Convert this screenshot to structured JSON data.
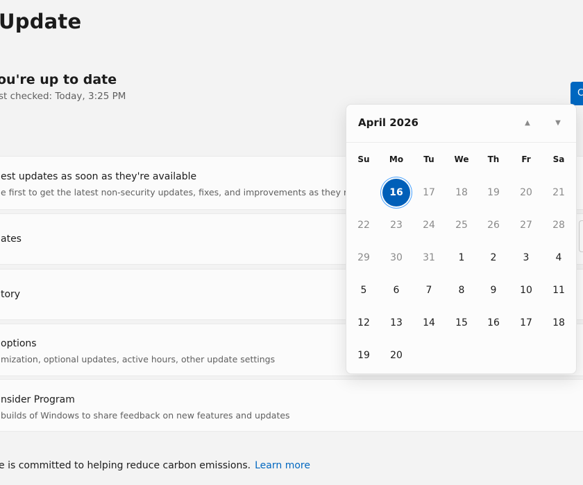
{
  "page": {
    "title": "Update",
    "status_title": "ou're up to date",
    "status_sub": "st checked: Today, 3:25 PM",
    "check_button": "C"
  },
  "rows": [
    {
      "title": "est updates as soon as they're available",
      "desc": "e first to get the latest non-security updates, fixes, and improvements as they roll o"
    },
    {
      "title": "ates",
      "desc": ""
    },
    {
      "title": "tory",
      "desc": ""
    },
    {
      "title": "options",
      "desc": "mization, optional updates, active hours, other update settings"
    },
    {
      "title": "nsider Program",
      "desc": "builds of Windows to share feedback on new features and updates"
    }
  ],
  "footer": {
    "text": "e is committed to helping reduce carbon emissions.",
    "link": "Learn more"
  },
  "calendar": {
    "month_label": "April 2026",
    "nav_up_icon": "▲",
    "nav_down_icon": "▼",
    "weekdays": [
      "Su",
      "Mo",
      "Tu",
      "We",
      "Th",
      "Fr",
      "Sa"
    ],
    "weeks": [
      [
        {
          "label": "",
          "state": "empty"
        },
        {
          "label": "16",
          "state": "selected"
        },
        {
          "label": "17",
          "state": "other"
        },
        {
          "label": "18",
          "state": "other"
        },
        {
          "label": "19",
          "state": "other"
        },
        {
          "label": "20",
          "state": "other"
        },
        {
          "label": "21",
          "state": "other"
        }
      ],
      [
        {
          "label": "22",
          "state": "other"
        },
        {
          "label": "23",
          "state": "other"
        },
        {
          "label": "24",
          "state": "other"
        },
        {
          "label": "25",
          "state": "other"
        },
        {
          "label": "26",
          "state": "other"
        },
        {
          "label": "27",
          "state": "other"
        },
        {
          "label": "28",
          "state": "other"
        }
      ],
      [
        {
          "label": "29",
          "state": "other"
        },
        {
          "label": "30",
          "state": "other"
        },
        {
          "label": "31",
          "state": "other"
        },
        {
          "label": "1",
          "state": "cur"
        },
        {
          "label": "2",
          "state": "cur"
        },
        {
          "label": "3",
          "state": "cur"
        },
        {
          "label": "4",
          "state": "cur"
        }
      ],
      [
        {
          "label": "5",
          "state": "cur"
        },
        {
          "label": "6",
          "state": "cur"
        },
        {
          "label": "7",
          "state": "cur"
        },
        {
          "label": "8",
          "state": "cur"
        },
        {
          "label": "9",
          "state": "cur"
        },
        {
          "label": "10",
          "state": "cur"
        },
        {
          "label": "11",
          "state": "cur"
        }
      ],
      [
        {
          "label": "12",
          "state": "cur"
        },
        {
          "label": "13",
          "state": "cur"
        },
        {
          "label": "14",
          "state": "cur"
        },
        {
          "label": "15",
          "state": "cur"
        },
        {
          "label": "16",
          "state": "cur"
        },
        {
          "label": "17",
          "state": "cur"
        },
        {
          "label": "18",
          "state": "cur"
        }
      ],
      [
        {
          "label": "19",
          "state": "cur"
        },
        {
          "label": "20",
          "state": "cur"
        }
      ]
    ]
  },
  "colors": {
    "accent": "#005fb8",
    "link": "#0067c0",
    "background": "#f3f3f3"
  }
}
